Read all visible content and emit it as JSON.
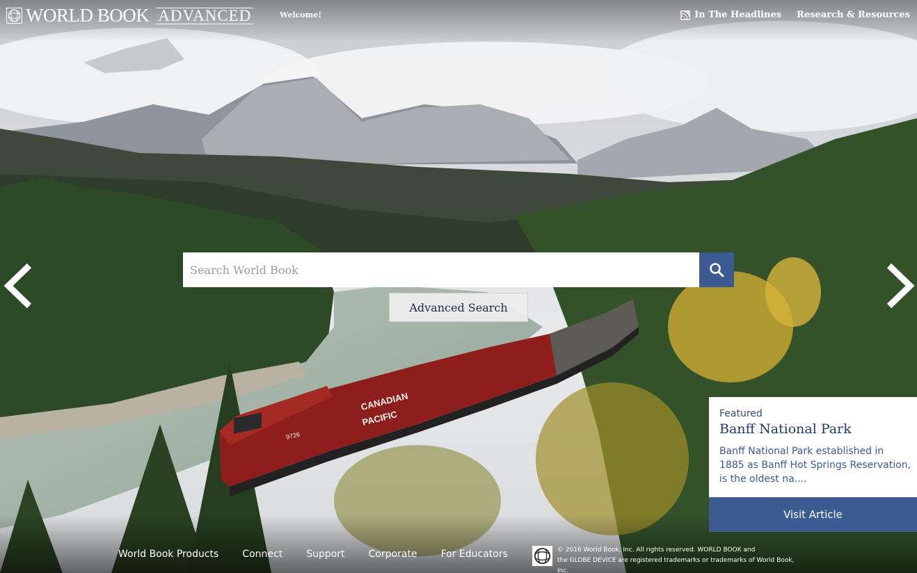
{
  "header": {
    "brand": "WORLD BOOK",
    "brand_sub": "ADVANCED",
    "welcome": "Welcome!",
    "nav": [
      {
        "label": "In The Headlines",
        "icon": "rss-icon"
      },
      {
        "label": "Research & Resources"
      }
    ]
  },
  "search": {
    "placeholder": "Search World Book",
    "button_icon": "search-icon",
    "advanced_label": "Advanced Search"
  },
  "carousel": {
    "prev_icon": "chevron-left-icon",
    "next_icon": "chevron-right-icon"
  },
  "featured": {
    "label": "Featured",
    "title": "Banff National Park",
    "description": "Banff National Park established in 1885 as Banff Hot Springs Reservation, is the oldest na....",
    "button": "Visit Article"
  },
  "background": {
    "train_text_1": "CANADIAN",
    "train_text_2": "PACIFIC",
    "train_number": "9726"
  },
  "footer": {
    "links": [
      "World Book Products",
      "Connect",
      "Support",
      "Corporate",
      "For Educators"
    ],
    "copyright_line1": "© 2016 World Book, Inc. All rights reserved. WORLD BOOK and",
    "copyright_line2": "the GLOBE DEVICE are registered trademarks or trademarks of World Book, Inc."
  },
  "colors": {
    "accent": "#3b5b92",
    "card_text": "#1f3a6e"
  }
}
